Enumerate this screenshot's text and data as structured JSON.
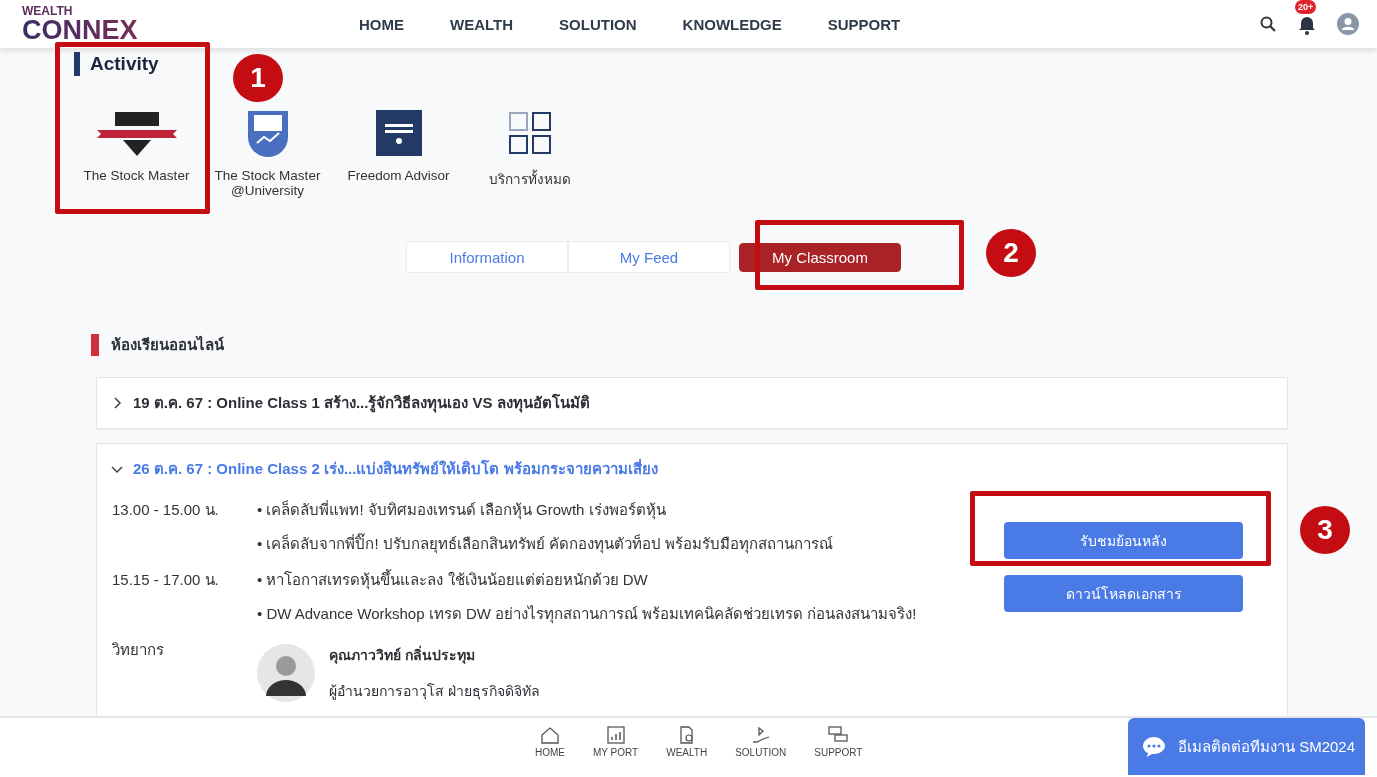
{
  "header": {
    "logo_top": "WEALTH",
    "logo_main": "CONNEX",
    "nav": [
      {
        "label": "HOME"
      },
      {
        "label": "WEALTH"
      },
      {
        "label": "SOLUTION"
      },
      {
        "label": "KNOWLEDGE"
      },
      {
        "label": "SUPPORT"
      }
    ],
    "notification_badge": "20+"
  },
  "activity": {
    "title": "Activity",
    "services": [
      {
        "label": "The Stock Master",
        "kind": "diy"
      },
      {
        "label": "The Stock Master @University",
        "kind": "shield"
      },
      {
        "label": "Freedom Advisor",
        "kind": "square"
      },
      {
        "label": "บริการทั้งหมด",
        "kind": "grid"
      }
    ]
  },
  "tabs": [
    {
      "label": "Information",
      "selected": false
    },
    {
      "label": "My Feed",
      "selected": false
    },
    {
      "label": "My Classroom",
      "selected": true
    }
  ],
  "section_title": "ห้องเรียนออนไลน์",
  "classes": [
    {
      "title": "19 ต.ค. 67 : Online Class 1 สร้าง...รู้จักวิธีลงทุนเอง VS ลงทุนอัตโนมัติ",
      "expanded": false
    },
    {
      "title": "26 ต.ค. 67 : Online Class 2 เร่ง...แบ่งสินทรัพย์ให้เติบโต พร้อมกระจายความเสี่ยง",
      "expanded": true,
      "sessions": [
        {
          "time": "13.00 - 15.00 น.",
          "topics": [
            "• เคล็ดลับพี่แพท! จับทิศมองเทรนด์ เลือกหุ้น Growth เร่งพอร์ตหุ้น",
            "• เคล็ดลับจากพี่ปิ๊ก! ปรับกลยุทธ์เลือกสินทรัพย์ คัดกองทุนตัวท็อป พร้อมรับมือทุกสถานการณ์"
          ]
        },
        {
          "time": "15.15 - 17.00 น.",
          "topics": [
            "• หาโอกาสเทรดหุ้นขึ้นและลง ใช้เงินน้อยแต่ต่อยหนักด้วย DW",
            "• DW Advance Workshop เทรด DW อย่างไรทุกสถานการณ์ พร้อมเทคนิคลัดช่วยเทรด ก่อนลงสนามจริง!"
          ]
        }
      ],
      "speaker_label": "วิทยากร",
      "speaker": {
        "name": "คุณภาววิทย์ กลิ่นประทุม",
        "role": "ผู้อำนวยการอาวุโส ฝ่ายธุรกิจดิจิทัล"
      },
      "buttons": [
        "รับชมย้อนหลัง",
        "ดาวน์โหลดเอกสาร"
      ]
    }
  ],
  "bottom_nav": [
    {
      "label": "HOME",
      "kind": "home"
    },
    {
      "label": "MY PORT",
      "kind": "port"
    },
    {
      "label": "WEALTH",
      "kind": "wealth"
    },
    {
      "label": "SOLUTION",
      "kind": "solution"
    },
    {
      "label": "SUPPORT",
      "kind": "support"
    }
  ],
  "chat_button": "อีเมลติดต่อทีมงาน SM2024",
  "annotations": [
    "1",
    "2",
    "3"
  ]
}
